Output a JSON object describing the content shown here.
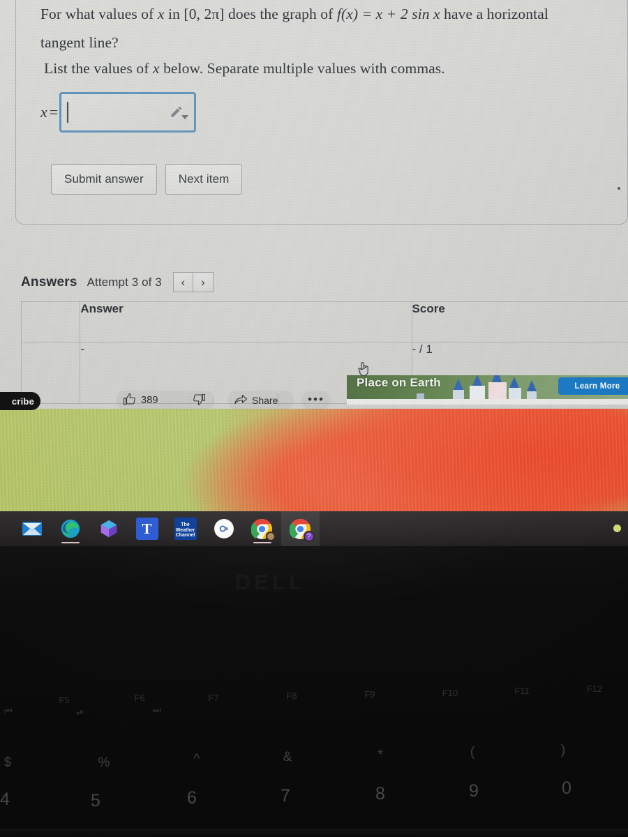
{
  "problem": {
    "question_line1_pre": "For what values of ",
    "question_line1_var": "x",
    "question_line1_mid": " in [0, 2π] does the graph of ",
    "question_line1_fn": "f(x) = x + 2 sin x",
    "question_line1_post": " have a horizontal",
    "question_line2": "tangent line?",
    "question_line3_pre": "List the values of ",
    "question_line3_var": "x",
    "question_line3_post": " below. Separate multiple values with commas.",
    "input_label": "x",
    "input_equals": "=",
    "input_value": "",
    "input_placeholder": "",
    "math_editor_icon": "pencil-icon",
    "math_editor_dropdown_icon": "chevron-down-icon"
  },
  "actions": {
    "submit_label": "Submit answer",
    "next_label": "Next item"
  },
  "answers": {
    "section_title": "Answers",
    "attempt_label": "Attempt 3 of 3",
    "prev_icon": "‹",
    "next_icon": "›",
    "columns": [
      "",
      "Answer",
      "Score"
    ],
    "rows": [
      {
        "spacer": "",
        "answer": "-",
        "score": "- / 1"
      }
    ]
  },
  "youtube": {
    "subscribe_label": "cribe",
    "like_icon": "thumbs-up-icon",
    "like_count": "389",
    "dislike_icon": "thumbs-down-icon",
    "share_icon": "share-arrow-icon",
    "share_label": "Share",
    "more_label": "•••",
    "ad_headline": "Place on Earth",
    "ad_cta_label": "Learn More",
    "ad_accent": "#1878c4"
  },
  "taskbar": {
    "items": [
      {
        "name": "mail-icon",
        "indicator": false
      },
      {
        "name": "edge-icon",
        "indicator": true
      },
      {
        "name": "copilot-icon",
        "indicator": false
      },
      {
        "name": "teams-icon",
        "label": "T",
        "indicator": false
      },
      {
        "name": "weather-channel-icon",
        "label": "The\nWeather\nChannel",
        "indicator": false
      },
      {
        "name": "disc-icon",
        "indicator": false
      },
      {
        "name": "chrome-icon",
        "indicator": true
      },
      {
        "name": "chrome-icon-profile",
        "indicator": false,
        "active": true
      }
    ]
  },
  "laptop": {
    "brand": "DELL",
    "fn_keys": [
      "F5",
      "F6",
      "F7",
      "F8",
      "F9",
      "F10",
      "F11",
      "F12"
    ],
    "media_glyphs": [
      "⏮",
      "⏯",
      "⏭"
    ],
    "symbol_row": [
      "$",
      "%",
      "^",
      "&",
      "*",
      "(",
      ")"
    ],
    "number_row": [
      "4",
      "5",
      "6",
      "7",
      "8",
      "9",
      "0"
    ]
  },
  "colors": {
    "input_border": "#5b93bd",
    "screen_bg": "#d3d3d0",
    "taskbar_bg": "#2b2829",
    "ad_blue": "#1878c4"
  }
}
